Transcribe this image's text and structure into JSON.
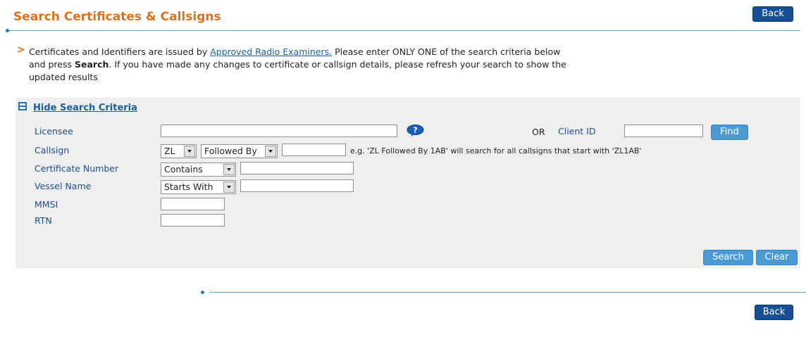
{
  "page": {
    "title": "Search Certificates & Callsigns",
    "back_label": "Back"
  },
  "intro": {
    "text_before_link": "Certificates and Identifiers are issued by ",
    "link_text": "Approved Radio Examiners.",
    "text_after_link": " Please enter ONLY ONE of the search criteria below and press ",
    "bold_word": "Search",
    "text_end": ". If you have made any changes to certificate or callsign details, please refresh your search to show the updated results"
  },
  "criteria": {
    "toggle_label": "Hide Search Criteria",
    "licensee_label": "Licensee",
    "licensee_value": "",
    "or_label": "OR",
    "client_id_label": "Client ID",
    "client_id_value": "",
    "find_label": "Find",
    "callsign_label": "Callsign",
    "callsign_prefix": "ZL",
    "callsign_mode": "Followed By",
    "callsign_value": "",
    "callsign_hint": "e.g. 'ZL Followed By 1AB' will search for all callsigns that start with 'ZL1AB'",
    "cert_label": "Certificate Number",
    "cert_mode": "Contains",
    "cert_value": "",
    "vessel_label": "Vessel Name",
    "vessel_mode": "Starts With",
    "vessel_value": "",
    "mmsi_label": "MMSI",
    "mmsi_value": "",
    "rtn_label": "RTN",
    "rtn_value": "",
    "search_label": "Search",
    "clear_label": "Clear"
  },
  "colors": {
    "title": "#e0701c",
    "link": "#1a5e9e",
    "primary_button": "#174f96",
    "secondary_button": "#4a9bd3",
    "panel_bg": "#efefef"
  },
  "icons": {
    "help": "help-bubble-icon",
    "collapse": "collapse-minus-icon",
    "bullet": "chevron-right-icon"
  }
}
